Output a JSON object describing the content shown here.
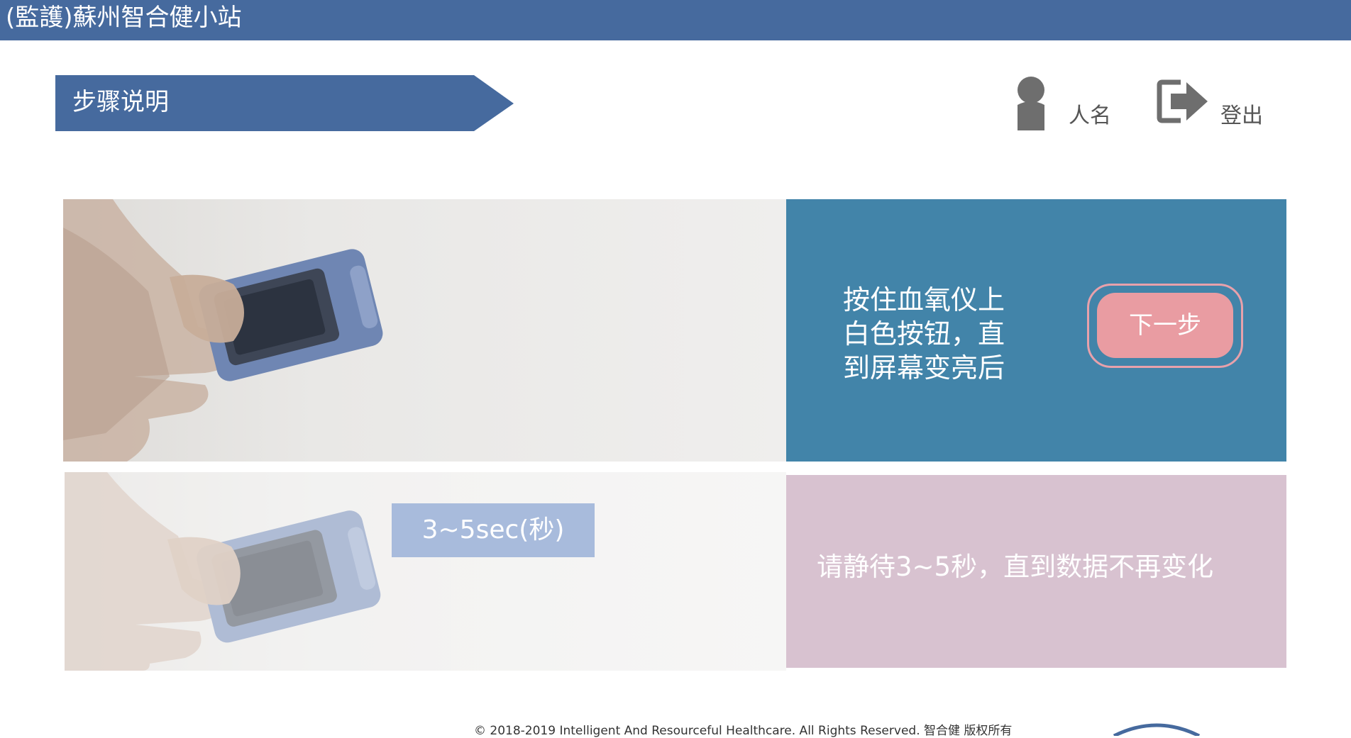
{
  "header": {
    "title": "(監護)蘇州智合健小站"
  },
  "step_banner": {
    "label": "步骤说明"
  },
  "user": {
    "icon": "person-icon",
    "name": "人名"
  },
  "logout": {
    "icon": "logout-icon",
    "label": "登出"
  },
  "steps": [
    {
      "instruction": "按住血氧仪上白色按钮，直到屏幕变亮后",
      "next_button": "下一步"
    },
    {
      "timer_badge": "3~5sec(秒)",
      "instruction": "请静待3~5秒，直到数据不再变化"
    }
  ],
  "footer": {
    "copyright": "© 2018-2019 Intelligent And Resourceful Healthcare. All Rights Reserved. 智合健 版权所有"
  },
  "colors": {
    "header_bg": "#466a9e",
    "banner_bg": "#466a9e",
    "step1_panel": "#4284a9",
    "step2_panel": "#d8c2d0",
    "next_button": "#e99ca2",
    "timer_badge": "#a8bbdc"
  }
}
